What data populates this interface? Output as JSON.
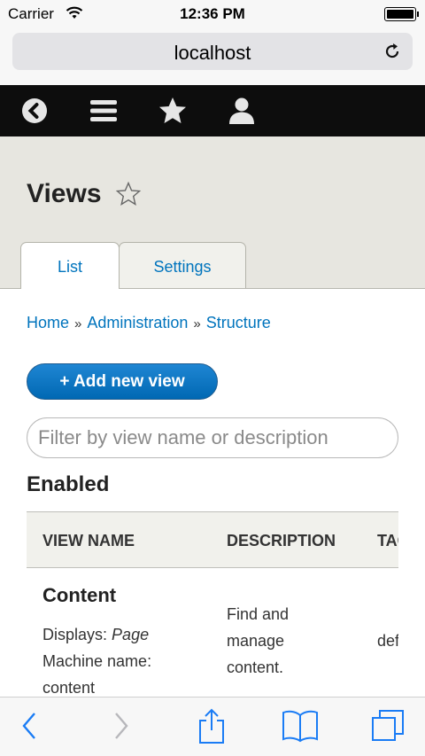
{
  "status": {
    "carrier": "Carrier",
    "time": "12:36 PM"
  },
  "browser": {
    "url": "localhost"
  },
  "page": {
    "title": "Views",
    "tabs": [
      {
        "label": "List"
      },
      {
        "label": "Settings"
      }
    ],
    "breadcrumb": [
      "Home",
      "Administration",
      "Structure"
    ],
    "breadcrumb_separator": "»",
    "add_button": "+ Add new view",
    "filter_placeholder": "Filter by view name or description",
    "section_title": "Enabled",
    "table": {
      "headers": [
        "VIEW NAME",
        "DESCRIPTION",
        "TAG"
      ],
      "rows": [
        {
          "name": "Content",
          "displays_label": "Displays:",
          "displays_value": "Page",
          "machine_label": "Machine name:",
          "machine_value": "content",
          "description": "Find and manage content.",
          "tag": "default"
        }
      ]
    }
  },
  "colors": {
    "link": "#0074bd",
    "toolbar": "#0d0d0d",
    "header_bg": "#e7e6e0",
    "button": "#0074bd",
    "ios_blue": "#1a7cf5"
  }
}
